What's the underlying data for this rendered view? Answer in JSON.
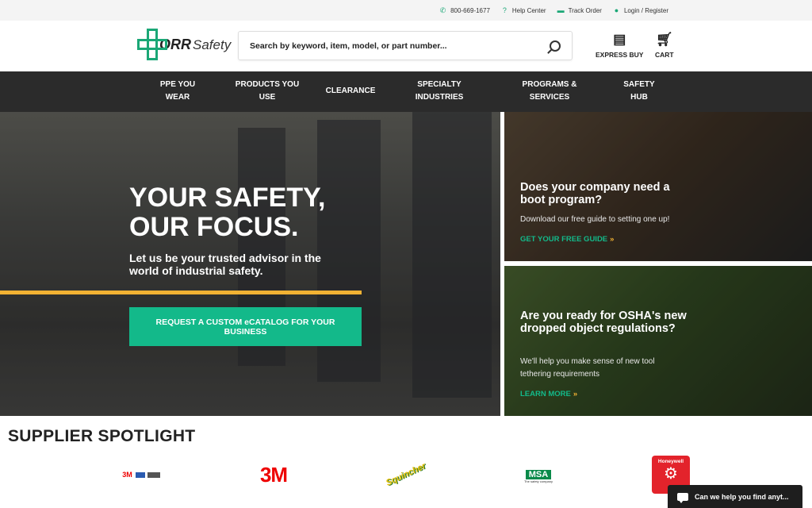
{
  "topbar": {
    "phone": "800-669-1677",
    "help": "Help Center",
    "track": "Track Order",
    "login": "Login / Register"
  },
  "logo": {
    "mark": "ORR",
    "name": "Safety"
  },
  "search": {
    "placeholder": "Search by keyword, item, model, or part number..."
  },
  "header_buttons": {
    "express": "EXPRESS BUY",
    "cart": "CART"
  },
  "nav": [
    {
      "line1": "PPE YOU",
      "line2": "WEAR"
    },
    {
      "line1": "PRODUCTS YOU",
      "line2": "USE"
    },
    {
      "line1": "CLEARANCE",
      "line2": ""
    },
    {
      "line1": "SPECIALTY",
      "line2": "INDUSTRIES"
    },
    {
      "line1": "PROGRAMS &",
      "line2": "SERVICES"
    },
    {
      "line1": "SAFETY",
      "line2": "HUB"
    }
  ],
  "hero": {
    "title1": "YOUR SAFETY,",
    "title2": "OUR FOCUS.",
    "subtitle": "Let us be your trusted advisor in the world of industrial safety.",
    "cta": "REQUEST A CUSTOM eCATALOG FOR YOUR BUSINESS"
  },
  "cards": [
    {
      "title": "Does your company need a boot program?",
      "text": "Download our free guide to setting one up!",
      "link": "GET YOUR FREE GUIDE"
    },
    {
      "title": "Are you ready for OSHA's new dropped object regulations?",
      "text": "We'll help you make sense of new tool tethering requirements",
      "link": "LEARN MORE"
    }
  ],
  "spotlight": {
    "title": "SUPPLIER SPOTLIGHT",
    "brands": [
      "3M",
      "3M",
      "Squincher",
      "MSA",
      "Honeywell"
    ],
    "msa_tag": "The safety company"
  },
  "chat": {
    "label": "Can we help you find anyt..."
  },
  "colors": {
    "accent": "#13b98a",
    "gold": "#f2b233",
    "nav": "#2b2b2b"
  }
}
